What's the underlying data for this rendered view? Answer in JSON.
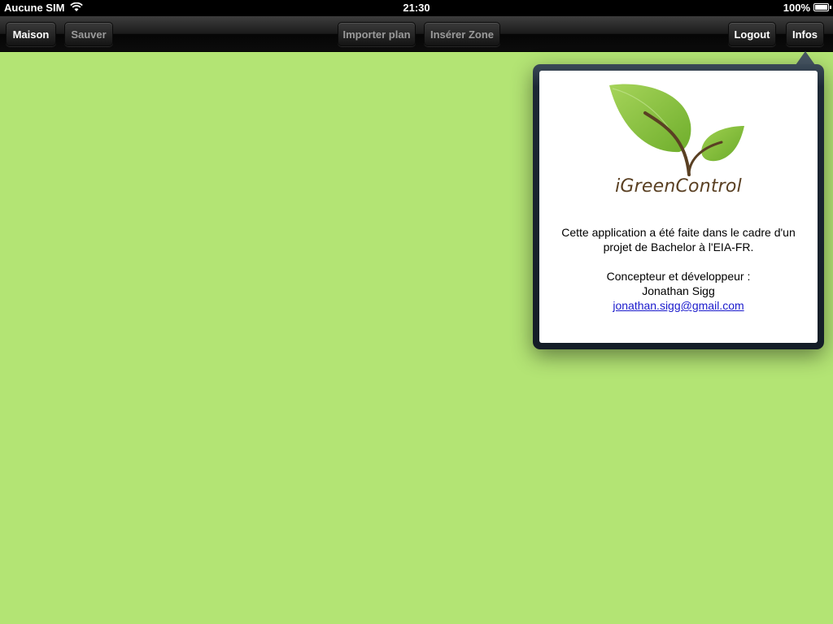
{
  "status_bar": {
    "carrier": "Aucune SIM",
    "time": "21:30",
    "battery": "100%",
    "battery_level": 1.0
  },
  "toolbar": {
    "maison": "Maison",
    "sauver": "Sauver",
    "importer_plan": "Importer plan",
    "inserer_zone": "Insérer Zone",
    "logout": "Logout",
    "infos": "Infos"
  },
  "popover": {
    "logo_text": "iGreenControl",
    "description_line1": "Cette application a été faite dans le cadre d'un",
    "description_line2": "projet de Bachelor à l'EIA-FR.",
    "credits_role": "Concepteur et développeur :",
    "credits_name": "Jonathan Sigg",
    "credits_email": "jonathan.sigg@gmail.com"
  },
  "colors": {
    "canvas_background": "#b3e474",
    "toolbar": "#1b1b1b",
    "logo_leaf": "#8dc63f",
    "logo_stem": "#5a4023",
    "link": "#1a1acc"
  },
  "icons": [
    "wifi-icon",
    "battery-icon",
    "igreencontrol-logo"
  ]
}
